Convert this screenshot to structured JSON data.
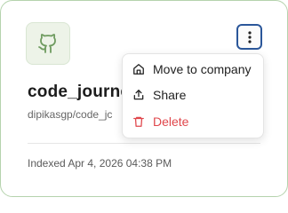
{
  "card": {
    "title": "code_journe",
    "path": "dipikasgp/code_jc",
    "indexed": "Indexed Apr 4, 2026 04:38 PM",
    "repo_icon": "github-icon",
    "more_icon": "more-vertical-icon"
  },
  "menu": {
    "items": [
      {
        "label": "Move to company",
        "icon": "home-icon"
      },
      {
        "label": "Share",
        "icon": "share-icon"
      },
      {
        "label": "Delete",
        "icon": "trash-icon"
      }
    ]
  },
  "colors": {
    "card_border": "#b5d3ad",
    "icon_green": "#6e9b5f",
    "focus_blue": "#2b579a",
    "danger": "#e0474c"
  }
}
